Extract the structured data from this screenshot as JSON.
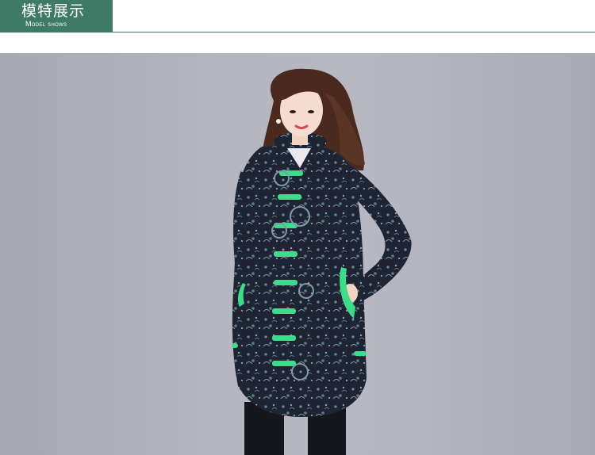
{
  "header": {
    "title": "模特展示",
    "subtitle": "Model shows",
    "accent_color": "#3f7a67"
  },
  "photo": {
    "subject": "model-wearing-printed-padded-coat",
    "background_color": "#b3b4be",
    "coat_color": "#1f2433",
    "button_color": "#3ddc8a"
  }
}
